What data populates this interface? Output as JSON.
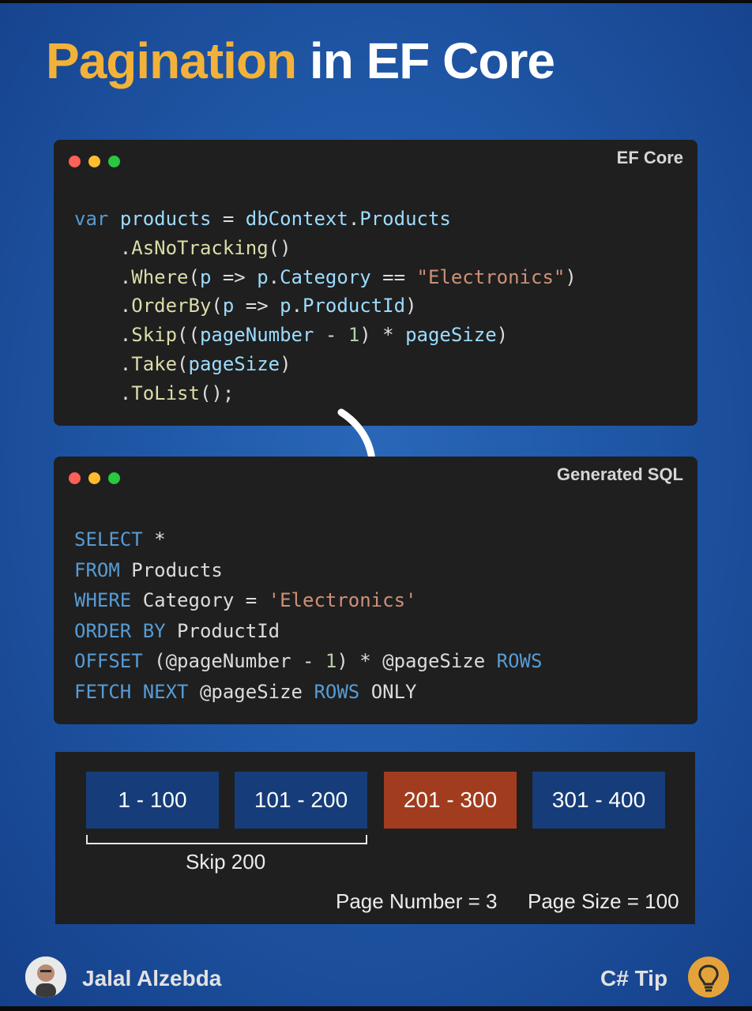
{
  "title": {
    "accent": "Pagination",
    "rest": "in EF Core"
  },
  "ef_panel": {
    "label": "EF Core",
    "lines": [
      [
        [
          "kw",
          "var"
        ],
        [
          "plain",
          " "
        ],
        [
          "id",
          "products"
        ],
        [
          "plain",
          " = "
        ],
        [
          "id",
          "dbContext"
        ],
        [
          "plain",
          "."
        ],
        [
          "id",
          "Products"
        ]
      ],
      [
        [
          "plain",
          "    ."
        ],
        [
          "fn",
          "AsNoTracking"
        ],
        [
          "plain",
          "()"
        ]
      ],
      [
        [
          "plain",
          "    ."
        ],
        [
          "fn",
          "Where"
        ],
        [
          "plain",
          "("
        ],
        [
          "id",
          "p"
        ],
        [
          "plain",
          " => "
        ],
        [
          "id",
          "p"
        ],
        [
          "plain",
          "."
        ],
        [
          "id",
          "Category"
        ],
        [
          "plain",
          " == "
        ],
        [
          "str",
          "\"Electronics\""
        ],
        [
          "plain",
          ")"
        ]
      ],
      [
        [
          "plain",
          "    ."
        ],
        [
          "fn",
          "OrderBy"
        ],
        [
          "plain",
          "("
        ],
        [
          "id",
          "p"
        ],
        [
          "plain",
          " => "
        ],
        [
          "id",
          "p"
        ],
        [
          "plain",
          "."
        ],
        [
          "id",
          "ProductId"
        ],
        [
          "plain",
          ")"
        ]
      ],
      [
        [
          "plain",
          "    ."
        ],
        [
          "fn",
          "Skip"
        ],
        [
          "plain",
          "(("
        ],
        [
          "id",
          "pageNumber"
        ],
        [
          "plain",
          " - "
        ],
        [
          "num",
          "1"
        ],
        [
          "plain",
          ") * "
        ],
        [
          "id",
          "pageSize"
        ],
        [
          "plain",
          ")"
        ]
      ],
      [
        [
          "plain",
          "    ."
        ],
        [
          "fn",
          "Take"
        ],
        [
          "plain",
          "("
        ],
        [
          "id",
          "pageSize"
        ],
        [
          "plain",
          ")"
        ]
      ],
      [
        [
          "plain",
          "    ."
        ],
        [
          "fn",
          "ToList"
        ],
        [
          "plain",
          "();"
        ]
      ]
    ]
  },
  "sql_panel": {
    "label": "Generated SQL",
    "lines": [
      [
        [
          "kw",
          "SELECT"
        ],
        [
          "plain",
          " *"
        ]
      ],
      [
        [
          "kw",
          "FROM"
        ],
        [
          "plain",
          " Products"
        ]
      ],
      [
        [
          "kw",
          "WHERE"
        ],
        [
          "plain",
          " Category = "
        ],
        [
          "str",
          "'Electronics'"
        ]
      ],
      [
        [
          "kw",
          "ORDER BY"
        ],
        [
          "plain",
          " ProductId"
        ]
      ],
      [
        [
          "kw",
          "OFFSET"
        ],
        [
          "plain",
          " (@pageNumber - "
        ],
        [
          "num",
          "1"
        ],
        [
          "plain",
          ") * @pageSize "
        ],
        [
          "kw",
          "ROWS"
        ]
      ],
      [
        [
          "kw",
          "FETCH NEXT"
        ],
        [
          "plain",
          " @pageSize "
        ],
        [
          "kw",
          "ROWS"
        ],
        [
          "plain",
          " ONLY"
        ]
      ]
    ]
  },
  "pages": [
    {
      "label": "1 - 100",
      "active": false
    },
    {
      "label": "101 - 200",
      "active": false
    },
    {
      "label": "201 - 300",
      "active": true
    },
    {
      "label": "301 - 400",
      "active": false
    }
  ],
  "skip_label": "Skip 200",
  "page_number_text": "Page Number = 3",
  "page_size_text": "Page Size = 100",
  "footer": {
    "author": "Jalal Alzebda",
    "tag": "C# Tip",
    "avatar_icon": "avatar",
    "tip_icon": "lightbulb-icon"
  },
  "colors": {
    "accent": "#f2b23a",
    "active_page": "#a23c1f",
    "page": "#163d7a",
    "keyword": "#569cd6",
    "identifier": "#9cdcfe",
    "method": "#dcdcaa",
    "string": "#ce9178",
    "number": "#b5cea8"
  }
}
